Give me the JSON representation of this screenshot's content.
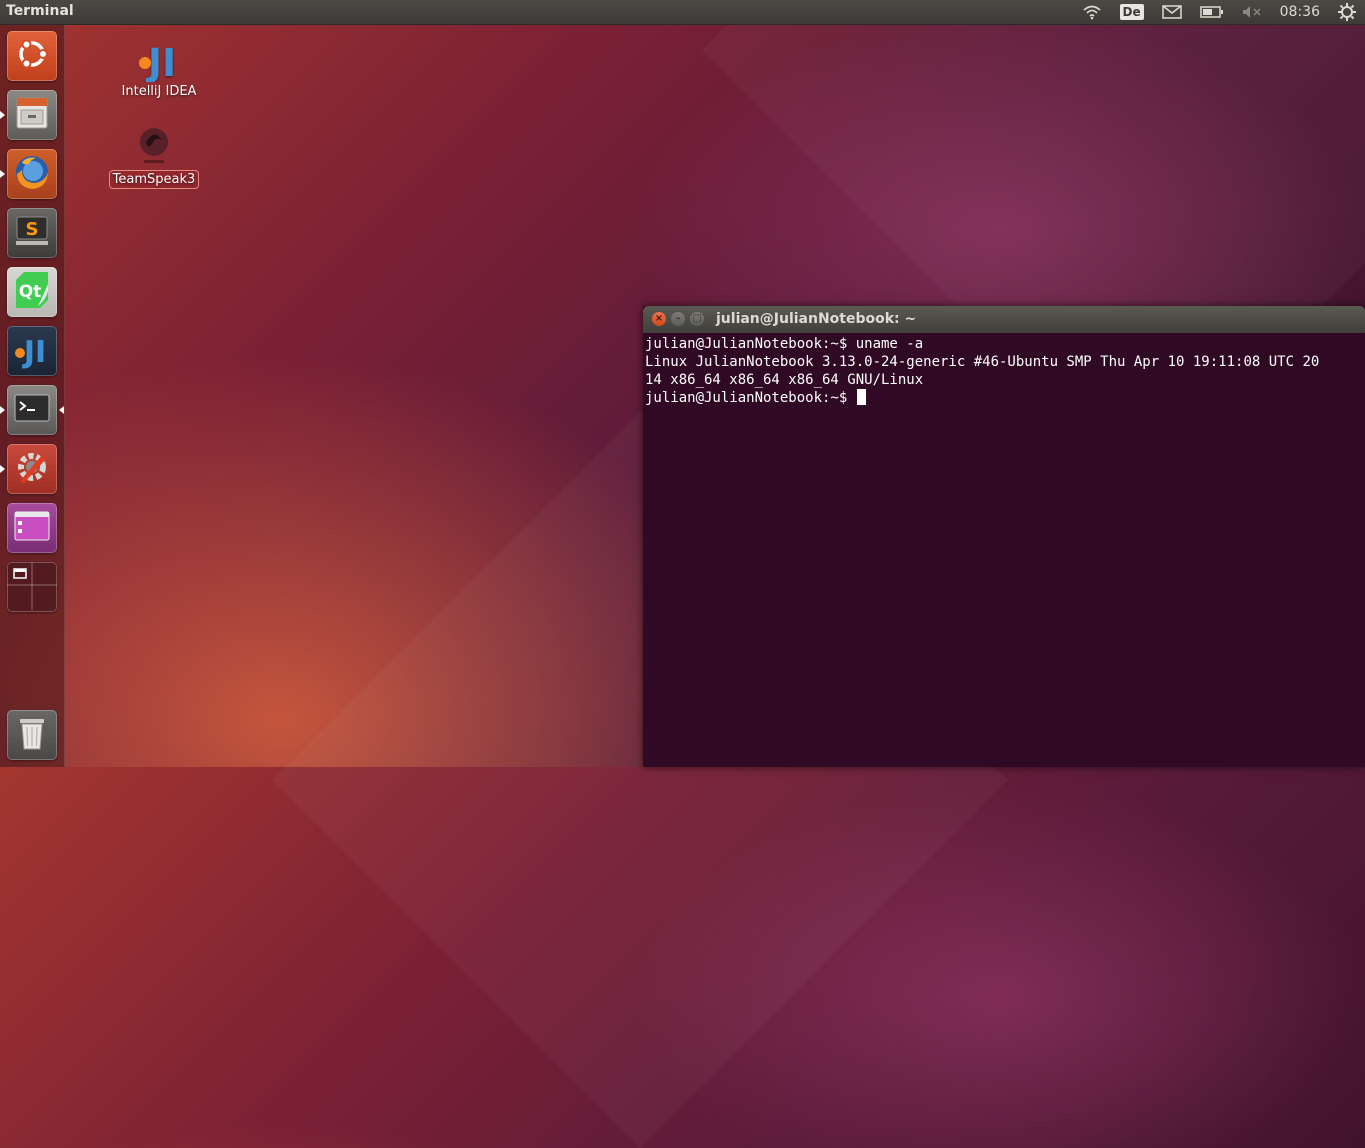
{
  "top_panel": {
    "app_title": "Terminal",
    "keyboard_layout": "De",
    "clock": "08:36",
    "icons": [
      "wifi-icon",
      "keyboard-layout-indicator",
      "mail-icon",
      "battery-icon",
      "volume-muted-icon",
      "gear-icon"
    ]
  },
  "launcher": {
    "items": [
      {
        "name": "dash-home",
        "icon": "ubuntu-logo-icon"
      },
      {
        "name": "files",
        "icon": "file-cabinet-icon"
      },
      {
        "name": "firefox",
        "icon": "firefox-icon"
      },
      {
        "name": "sublime-text",
        "icon": "sublime-text-icon"
      },
      {
        "name": "qt-creator",
        "icon": "qt-icon"
      },
      {
        "name": "intellij-idea",
        "icon": "intellij-icon"
      },
      {
        "name": "terminal",
        "icon": "terminal-icon"
      },
      {
        "name": "system-settings",
        "icon": "settings-tools-icon"
      },
      {
        "name": "software-center",
        "icon": "window-purple-icon"
      },
      {
        "name": "workspace-switcher",
        "icon": "workspace-switcher-icon"
      },
      {
        "name": "trash",
        "icon": "trash-icon"
      }
    ]
  },
  "desktop": {
    "icons": [
      {
        "label": "IntelliJ IDEA",
        "icon": "intellij-icon"
      },
      {
        "label": "TeamSpeak3",
        "icon": "teamspeak-icon"
      }
    ]
  },
  "terminal": {
    "title": "julian@JulianNotebook: ~",
    "lines": [
      "julian@JulianNotebook:~$ uname -a",
      "Linux JulianNotebook 3.13.0-24-generic #46-Ubuntu SMP Thu Apr 10 19:11:08 UTC 20",
      "14 x86_64 x86_64 x86_64 GNU/Linux",
      "julian@JulianNotebook:~$ "
    ]
  },
  "colors": {
    "terminal_bg": "#300a24",
    "panel_bg": "#3c3b37",
    "close_button": "#e0542a"
  }
}
